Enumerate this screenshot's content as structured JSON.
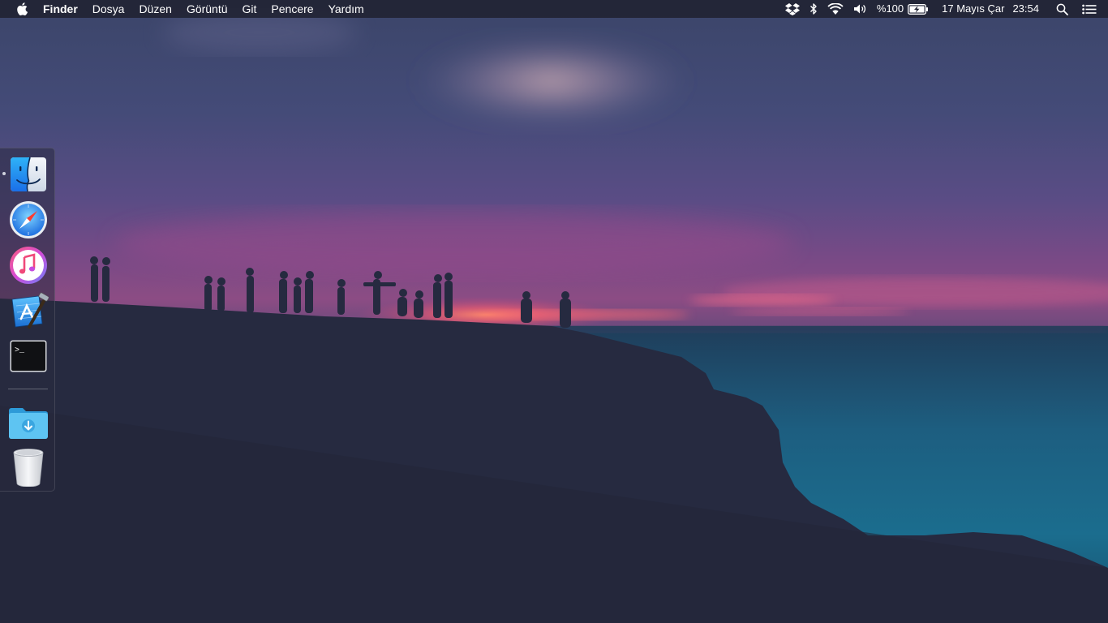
{
  "menubar": {
    "app_name": "Finder",
    "menus": [
      "Dosya",
      "Düzen",
      "Görüntü",
      "Git",
      "Pencere",
      "Yardım"
    ],
    "status": {
      "battery_percent": "%100",
      "date": "17 Mayıs Çar",
      "time": "23:54"
    }
  },
  "dock": {
    "items": [
      {
        "name": "Finder",
        "running": true
      },
      {
        "name": "Safari",
        "running": false
      },
      {
        "name": "iTunes",
        "running": false
      },
      {
        "name": "Xcode",
        "running": false
      },
      {
        "name": "Terminal",
        "running": false
      },
      {
        "name": "Downloads",
        "running": false
      },
      {
        "name": "Trash",
        "running": false
      }
    ],
    "terminal_prompt": ">_"
  },
  "icons": {
    "apple": "apple-logo-icon",
    "dropbox": "dropbox-icon",
    "bluetooth": "bluetooth-icon",
    "wifi": "wifi-icon",
    "volume": "volume-icon",
    "battery": "battery-charging-icon",
    "search": "spotlight-search-icon",
    "notifications": "notification-center-icon"
  },
  "colors": {
    "menubar_bg": "#222434",
    "sky_top": "#3a4468",
    "sky_pink": "#8a4a86",
    "sunset": "#ff6a5a",
    "sea": "#1f6f8f",
    "cliff": "#262a3f"
  }
}
